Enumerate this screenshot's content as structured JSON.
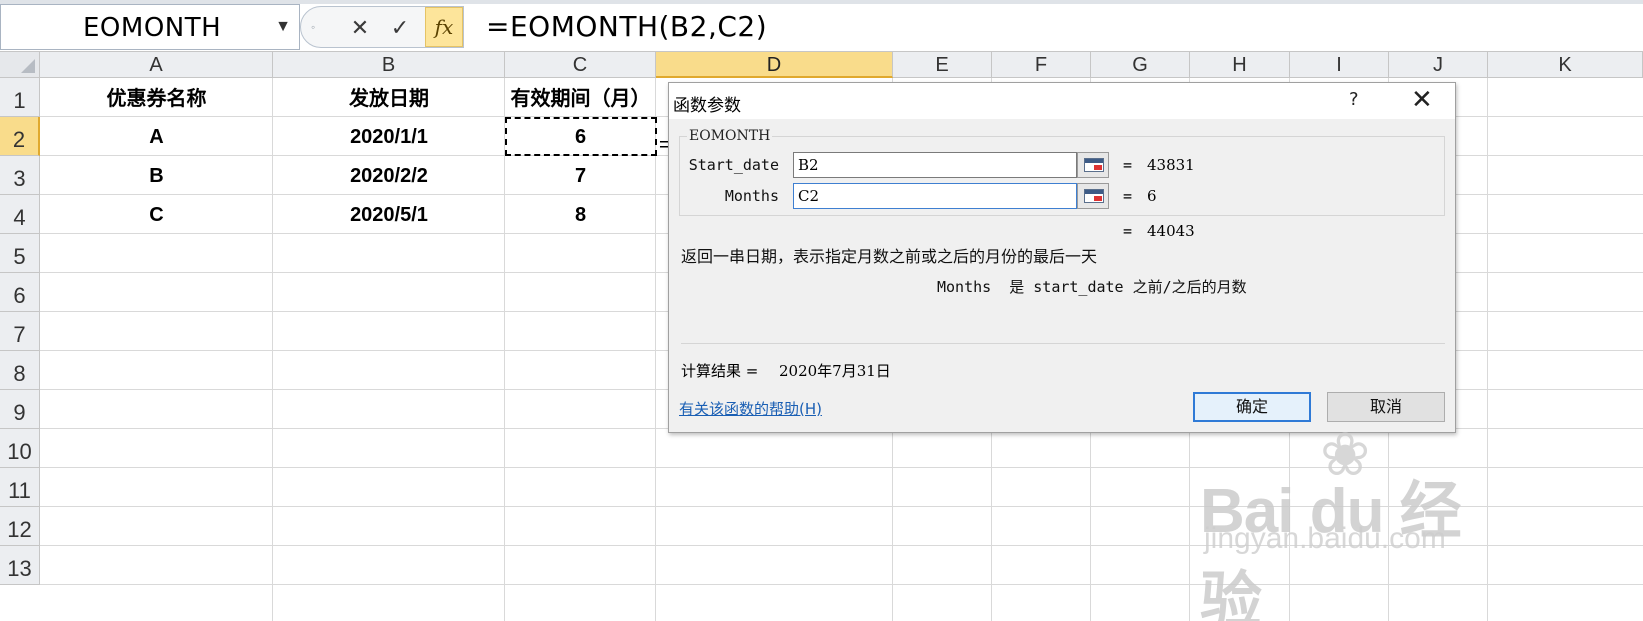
{
  "formula_bar": {
    "name_box": "EOMONTH",
    "cancel_glyph": "✕",
    "enter_glyph": "✓",
    "insert_fn_label": "fx",
    "formula": "=EOMONTH(B2,C2)"
  },
  "sheet": {
    "columns": [
      "A",
      "B",
      "C",
      "D",
      "E",
      "F",
      "G",
      "H",
      "I",
      "J",
      "K"
    ],
    "active_column": "D",
    "rows": [
      "1",
      "2",
      "3",
      "4",
      "5",
      "6",
      "7",
      "8",
      "9",
      "10",
      "11",
      "12",
      "13"
    ],
    "active_row": "2",
    "headers": [
      "优惠券名称",
      "发放日期",
      "有效期间（月）"
    ],
    "data": [
      [
        "A",
        "2020/1/1",
        "6"
      ],
      [
        "B",
        "2020/2/2",
        "7"
      ],
      [
        "C",
        "2020/5/1",
        "8"
      ]
    ],
    "d2_stub": "="
  },
  "dialog": {
    "title": "函数参数",
    "help_glyph": "?",
    "close_glyph": "✕",
    "function_name": "EOMONTH",
    "args": [
      {
        "label": "Start_date",
        "value": "B2",
        "result": "43831"
      },
      {
        "label": "Months",
        "value": "C2",
        "result": "6"
      }
    ],
    "equals": "=",
    "formula_result": "44043",
    "description": "返回一串日期，表示指定月数之前或之后的月份的最后一天",
    "arg_description": "Months  是 start_date 之前/之后的月数",
    "calc_result_label": "计算结果 =",
    "calc_result_value": "2020年7月31日",
    "help_link": "有关该函数的帮助(H)",
    "ok_label": "确定",
    "cancel_label": "取消"
  },
  "watermark": {
    "brand": "Bai du 经验",
    "url": "jingyan.baidu.com"
  },
  "colors": {
    "active_header": "#f9dc8b",
    "dialog_bg": "#f0f0f0",
    "link": "#1a5fb4",
    "ok_border": "#2f7ad6"
  }
}
